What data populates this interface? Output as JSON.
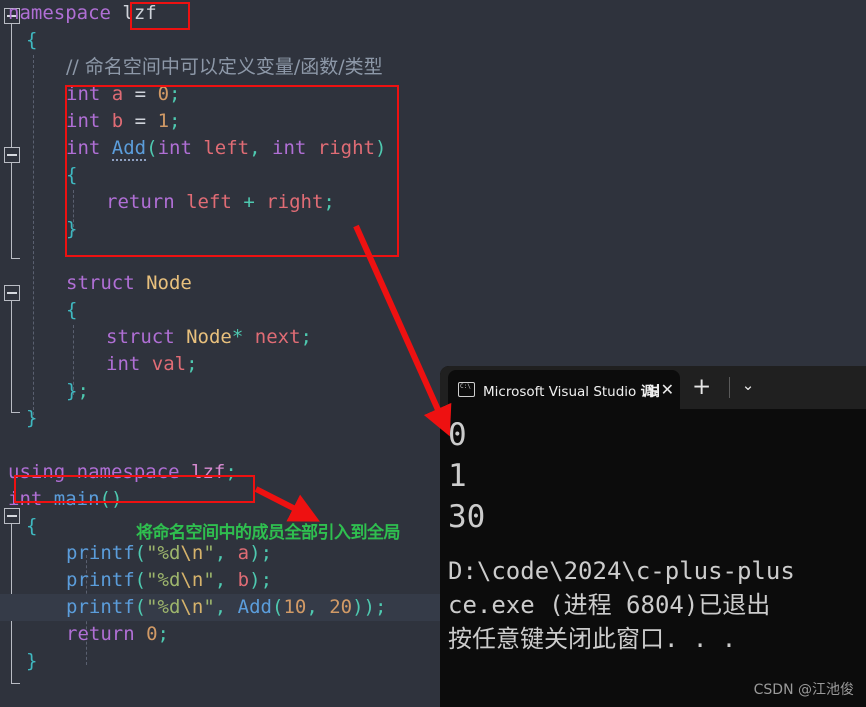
{
  "editor": {
    "lines": [
      {
        "indent": 0,
        "tokens": [
          {
            "t": "namespace ",
            "c": "kw"
          },
          {
            "t": "lzf",
            "c": "ns"
          }
        ]
      },
      {
        "indent": 1,
        "tokens": [
          {
            "t": "{",
            "c": "brace"
          }
        ]
      },
      {
        "indent": 2,
        "tokens": [
          {
            "t": "// 命名空间中可以定义变量/函数/类型",
            "c": "cmt"
          }
        ]
      },
      {
        "indent": 2,
        "tokens": [
          {
            "t": "int",
            "c": "kw"
          },
          {
            "t": " ",
            "c": "plain"
          },
          {
            "t": "a",
            "c": "var"
          },
          {
            "t": " = ",
            "c": "plain"
          },
          {
            "t": "0",
            "c": "num"
          },
          {
            "t": ";",
            "c": "punc"
          }
        ]
      },
      {
        "indent": 2,
        "tokens": [
          {
            "t": "int",
            "c": "kw"
          },
          {
            "t": " ",
            "c": "plain"
          },
          {
            "t": "b",
            "c": "var"
          },
          {
            "t": " = ",
            "c": "plain"
          },
          {
            "t": "1",
            "c": "num"
          },
          {
            "t": ";",
            "c": "punc"
          }
        ]
      },
      {
        "indent": 2,
        "tokens": [
          {
            "t": "int",
            "c": "kw"
          },
          {
            "t": " ",
            "c": "plain"
          },
          {
            "t": "Add",
            "c": "fn dotted"
          },
          {
            "t": "(",
            "c": "punc"
          },
          {
            "t": "int",
            "c": "kw"
          },
          {
            "t": " ",
            "c": "plain"
          },
          {
            "t": "left",
            "c": "var"
          },
          {
            "t": ", ",
            "c": "punc"
          },
          {
            "t": "int",
            "c": "kw"
          },
          {
            "t": " ",
            "c": "plain"
          },
          {
            "t": "right",
            "c": "var"
          },
          {
            "t": ")",
            "c": "punc"
          }
        ]
      },
      {
        "indent": 2,
        "tokens": [
          {
            "t": "{",
            "c": "brace"
          }
        ]
      },
      {
        "indent": 3,
        "tokens": [
          {
            "t": "return",
            "c": "kw"
          },
          {
            "t": " ",
            "c": "plain"
          },
          {
            "t": "left",
            "c": "var"
          },
          {
            "t": " ",
            "c": "plain"
          },
          {
            "t": "+",
            "c": "op"
          },
          {
            "t": " ",
            "c": "plain"
          },
          {
            "t": "right",
            "c": "var"
          },
          {
            "t": ";",
            "c": "punc"
          }
        ]
      },
      {
        "indent": 2,
        "tokens": [
          {
            "t": "}",
            "c": "brace"
          }
        ]
      },
      {
        "indent": 0,
        "tokens": []
      },
      {
        "indent": 2,
        "tokens": [
          {
            "t": "struct",
            "c": "kw"
          },
          {
            "t": " ",
            "c": "plain"
          },
          {
            "t": "Node",
            "c": "type"
          }
        ]
      },
      {
        "indent": 2,
        "tokens": [
          {
            "t": "{",
            "c": "brace"
          }
        ]
      },
      {
        "indent": 3,
        "tokens": [
          {
            "t": "struct",
            "c": "kw"
          },
          {
            "t": " ",
            "c": "plain"
          },
          {
            "t": "Node",
            "c": "type"
          },
          {
            "t": "*",
            "c": "op"
          },
          {
            "t": " ",
            "c": "plain"
          },
          {
            "t": "next",
            "c": "var"
          },
          {
            "t": ";",
            "c": "punc"
          }
        ]
      },
      {
        "indent": 3,
        "tokens": [
          {
            "t": "int",
            "c": "kw"
          },
          {
            "t": " ",
            "c": "plain"
          },
          {
            "t": "val",
            "c": "var"
          },
          {
            "t": ";",
            "c": "punc"
          }
        ]
      },
      {
        "indent": 2,
        "tokens": [
          {
            "t": "}",
            "c": "brace"
          },
          {
            "t": ";",
            "c": "punc"
          }
        ]
      },
      {
        "indent": 1,
        "tokens": [
          {
            "t": "}",
            "c": "brace"
          }
        ]
      },
      {
        "indent": 0,
        "tokens": []
      },
      {
        "indent": 0,
        "tokens": [
          {
            "t": "using namespace",
            "c": "kw"
          },
          {
            "t": " ",
            "c": "plain"
          },
          {
            "t": "lzf",
            "c": "nspink"
          },
          {
            "t": ";",
            "c": "punc"
          }
        ]
      },
      {
        "indent": 0,
        "tokens": [
          {
            "t": "int",
            "c": "kw"
          },
          {
            "t": " ",
            "c": "plain"
          },
          {
            "t": "main",
            "c": "fn"
          },
          {
            "t": "()",
            "c": "punc"
          }
        ]
      },
      {
        "indent": 1,
        "tokens": [
          {
            "t": "{",
            "c": "brace"
          }
        ]
      },
      {
        "indent": 2,
        "tokens": [
          {
            "t": "printf",
            "c": "fn"
          },
          {
            "t": "(",
            "c": "punc"
          },
          {
            "t": "\"%d",
            "c": "str"
          },
          {
            "t": "\\n",
            "c": "esc"
          },
          {
            "t": "\"",
            "c": "str"
          },
          {
            "t": ", ",
            "c": "punc"
          },
          {
            "t": "a",
            "c": "var"
          },
          {
            "t": ")",
            "c": "punc"
          },
          {
            "t": ";",
            "c": "punc"
          }
        ]
      },
      {
        "indent": 2,
        "tokens": [
          {
            "t": "printf",
            "c": "fn"
          },
          {
            "t": "(",
            "c": "punc"
          },
          {
            "t": "\"%d",
            "c": "str"
          },
          {
            "t": "\\n",
            "c": "esc"
          },
          {
            "t": "\"",
            "c": "str"
          },
          {
            "t": ", ",
            "c": "punc"
          },
          {
            "t": "b",
            "c": "var"
          },
          {
            "t": ")",
            "c": "punc"
          },
          {
            "t": ";",
            "c": "punc"
          }
        ]
      },
      {
        "indent": 2,
        "highlight": true,
        "tokens": [
          {
            "t": "printf",
            "c": "fn"
          },
          {
            "t": "(",
            "c": "punc"
          },
          {
            "t": "\"%d",
            "c": "str"
          },
          {
            "t": "\\n",
            "c": "esc"
          },
          {
            "t": "\"",
            "c": "str"
          },
          {
            "t": ", ",
            "c": "punc"
          },
          {
            "t": "Add",
            "c": "fn"
          },
          {
            "t": "(",
            "c": "punc"
          },
          {
            "t": "10",
            "c": "num"
          },
          {
            "t": ", ",
            "c": "punc"
          },
          {
            "t": "20",
            "c": "num"
          },
          {
            "t": "))",
            "c": "punc"
          },
          {
            "t": ";",
            "c": "punc"
          }
        ]
      },
      {
        "indent": 2,
        "tokens": [
          {
            "t": "return",
            "c": "kw"
          },
          {
            "t": " ",
            "c": "plain"
          },
          {
            "t": "0",
            "c": "num"
          },
          {
            "t": ";",
            "c": "punc"
          }
        ]
      },
      {
        "indent": 1,
        "tokens": [
          {
            "t": "}",
            "c": "brace"
          }
        ]
      }
    ]
  },
  "annotations": {
    "green_note": "将命名空间中的成员全部引入到全局",
    "highlight_color": "#ee1111",
    "note_color": "#2fbf4f"
  },
  "terminal": {
    "tab_title_prefix": "Microsoft Visual Studio ",
    "tab_title_cn": "调试控",
    "close_label": "✕",
    "new_tab_label": "+",
    "dropdown_label": "⌄",
    "icon_label": "C:\\",
    "output_lines": [
      "0",
      "1",
      "30"
    ],
    "message_lines": [
      "D:\\code\\2024\\c-plus-plus",
      "ce.exe (进程 6804)已退出",
      "按任意键关闭此窗口. . ."
    ]
  },
  "watermark": "CSDN @江池俊"
}
